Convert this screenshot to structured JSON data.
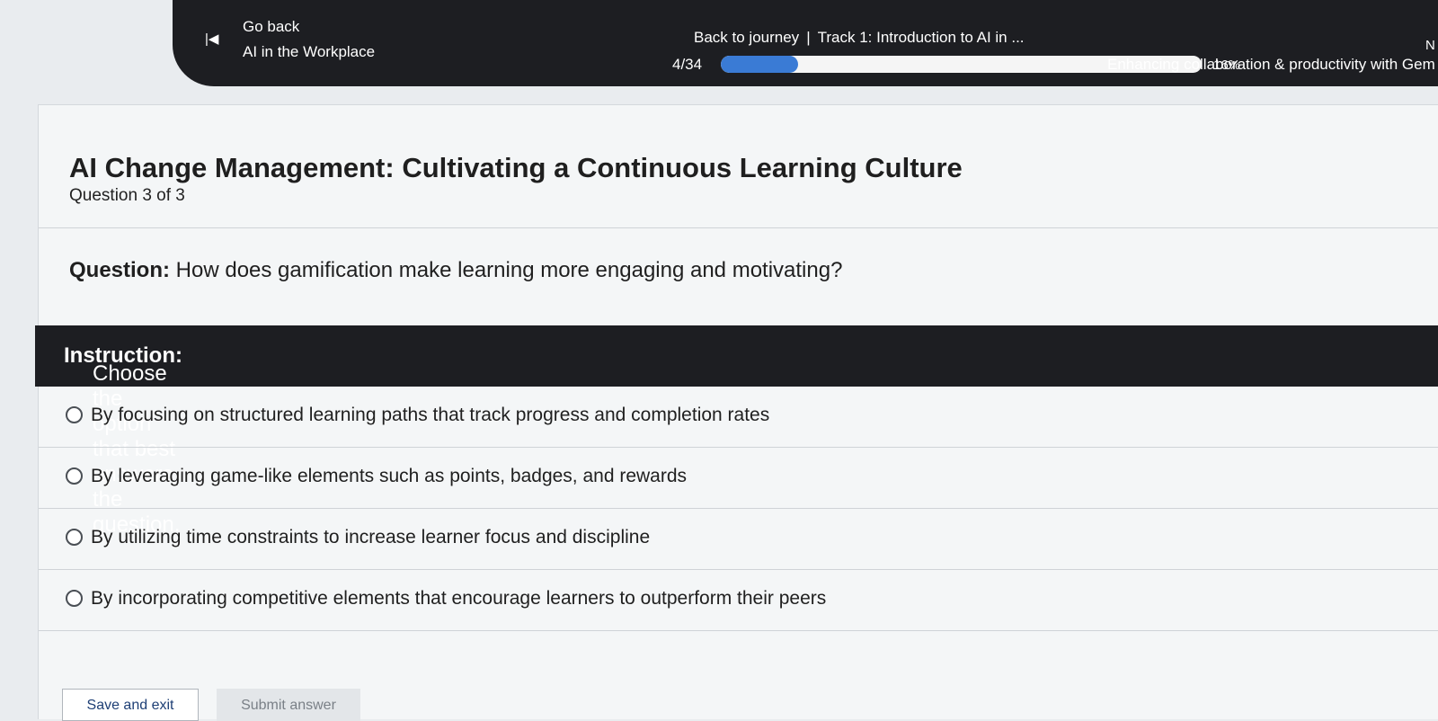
{
  "header": {
    "back_icon": "skip-back-icon",
    "back_glyph": "|◀",
    "go_back_label": "Go back",
    "course_name": "AI in the Workplace",
    "back_to_journey_label": "Back to journey",
    "separator": "|",
    "track_label": "Track 1: Introduction to AI in ...",
    "counter": "4/34",
    "progress_percent": 16,
    "progress_label": "16%",
    "section_title": "Enhancing collaboration & productivity with Gem",
    "next_edge_glyph": "N"
  },
  "quiz": {
    "title": "AI Change Management: Cultivating a Continuous Learning Culture",
    "question_count": "Question 3 of 3",
    "question_label": "Question:",
    "question_text": " How does gamification make learning more engaging and motivating?",
    "instruction_label": "Instruction:",
    "instruction_text": " Choose the option that best answers the question.",
    "options": [
      "By focusing on structured learning paths that track progress and completion rates",
      "By leveraging game-like elements such as points, badges, and rewards",
      "By utilizing time constraints to increase learner focus and discipline",
      "By incorporating competitive elements that encourage learners to outperform their peers"
    ]
  },
  "actions": {
    "save_exit_label": "Save and exit",
    "submit_label": "Submit answer"
  },
  "colors": {
    "header_bg": "#1d1e22",
    "progress_fill": "#3a7bd5",
    "page_bg": "#f4f6f7"
  }
}
